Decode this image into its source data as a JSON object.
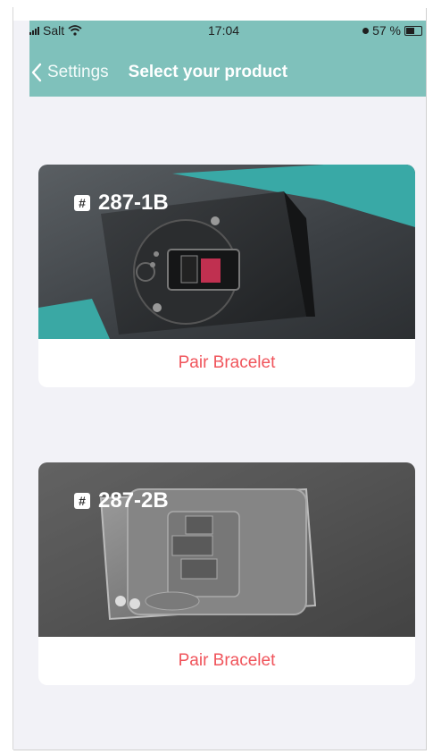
{
  "status_bar": {
    "carrier": "Salt",
    "time": "17:04",
    "battery": "57 %"
  },
  "nav": {
    "back_label": "Settings",
    "title": "Select your product"
  },
  "products": [
    {
      "model": "287-1B",
      "action_label": "Pair Bracelet"
    },
    {
      "model": "287-2B",
      "action_label": "Pair Bracelet"
    }
  ],
  "colors": {
    "header": "#7fc1bb",
    "action_text": "#f0545b",
    "background": "#f2f2f7"
  }
}
